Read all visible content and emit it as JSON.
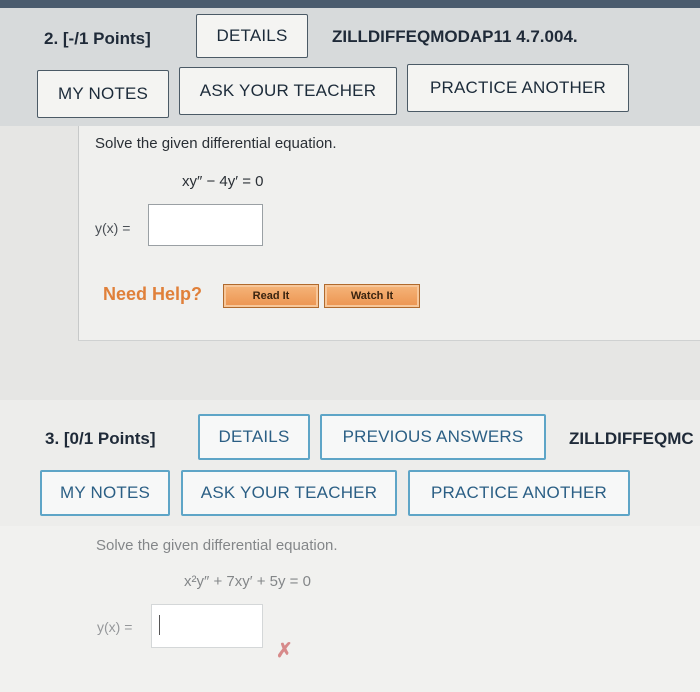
{
  "question2": {
    "number": "2. [-/1 Points]",
    "details_label": "DETAILS",
    "code": "ZILLDIFFEQMODAP11 4.7.004.",
    "my_notes_label": "MY NOTES",
    "ask_teacher_label": "ASK YOUR TEACHER",
    "practice_label": "PRACTICE ANOTHER",
    "prompt": "Solve the given differential equation.",
    "equation": "xy″ − 4y′ = 0",
    "answer_label": "y(x) =",
    "answer_value": "",
    "need_help": "Need Help?",
    "read_it": "Read It",
    "watch_it": "Watch It"
  },
  "question3": {
    "number": "3. [0/1 Points]",
    "details_label": "DETAILS",
    "previous_answers_label": "PREVIOUS ANSWERS",
    "code": "ZILLDIFFEQMC",
    "my_notes_label": "MY NOTES",
    "ask_teacher_label": "ASK YOUR TEACHER",
    "practice_label": "PRACTICE ANOTHER",
    "prompt": "Solve the given differential equation.",
    "equation": "x²y″ + 7xy′ + 5y = 0",
    "answer_label": "y(x) =",
    "answer_value": "",
    "status_icon": "x-mark"
  },
  "colors": {
    "help_orange": "#e0803a",
    "incorrect": "#d78a8a",
    "link_blue": "#5ea5c7"
  }
}
